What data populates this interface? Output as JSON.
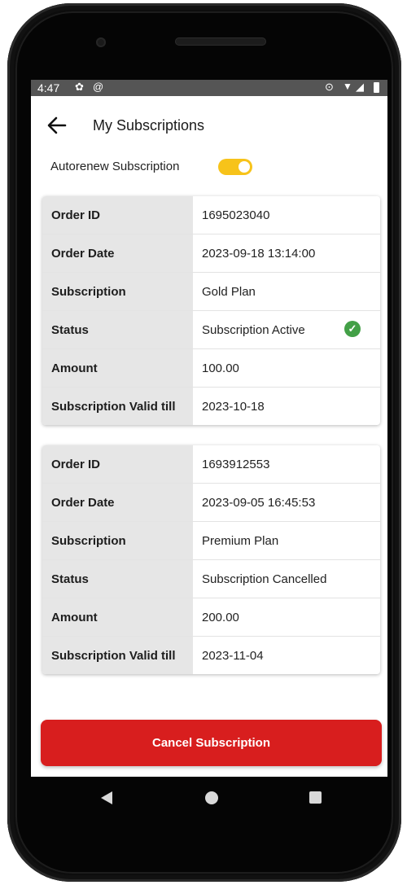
{
  "status_bar": {
    "time": "4:47",
    "icons": [
      "gear-icon",
      "at-sign-icon",
      "location-icon",
      "wifi-icon",
      "signal-icon",
      "battery-icon"
    ]
  },
  "app_bar": {
    "title": "My Subscriptions",
    "back_icon": "arrow-left-icon"
  },
  "autorenew": {
    "label": "Autorenew Subscription",
    "enabled": true,
    "color": "#f7c31a"
  },
  "orders": [
    {
      "rows": [
        {
          "key": "Order ID",
          "value": "1695023040"
        },
        {
          "key": "Order Date",
          "value": "2023-09-18 13:14:00"
        },
        {
          "key": "Subscription",
          "value": "Gold Plan"
        },
        {
          "key": "Status",
          "value": "Subscription Active"
        },
        {
          "key": "Amount",
          "value": "100.00"
        },
        {
          "key": "Subscription Valid till",
          "value": "2023-10-18"
        }
      ],
      "status_icon": "check-circle-icon",
      "status_color": "#43a047"
    },
    {
      "rows": [
        {
          "key": "Order ID",
          "value": "1693912553"
        },
        {
          "key": "Order Date",
          "value": "2023-09-05 16:45:53"
        },
        {
          "key": "Subscription",
          "value": "Premium Plan"
        },
        {
          "key": "Status",
          "value": "Subscription Cancelled"
        },
        {
          "key": "Amount",
          "value": "200.00"
        },
        {
          "key": "Subscription Valid till",
          "value": "2023-11-04"
        }
      ]
    }
  ],
  "cancel_button": {
    "label": "Cancel Subscription",
    "color": "#d81e1e"
  },
  "nav_bar": {
    "icons": [
      "back-triangle-icon",
      "home-circle-icon",
      "recents-square-icon"
    ]
  }
}
